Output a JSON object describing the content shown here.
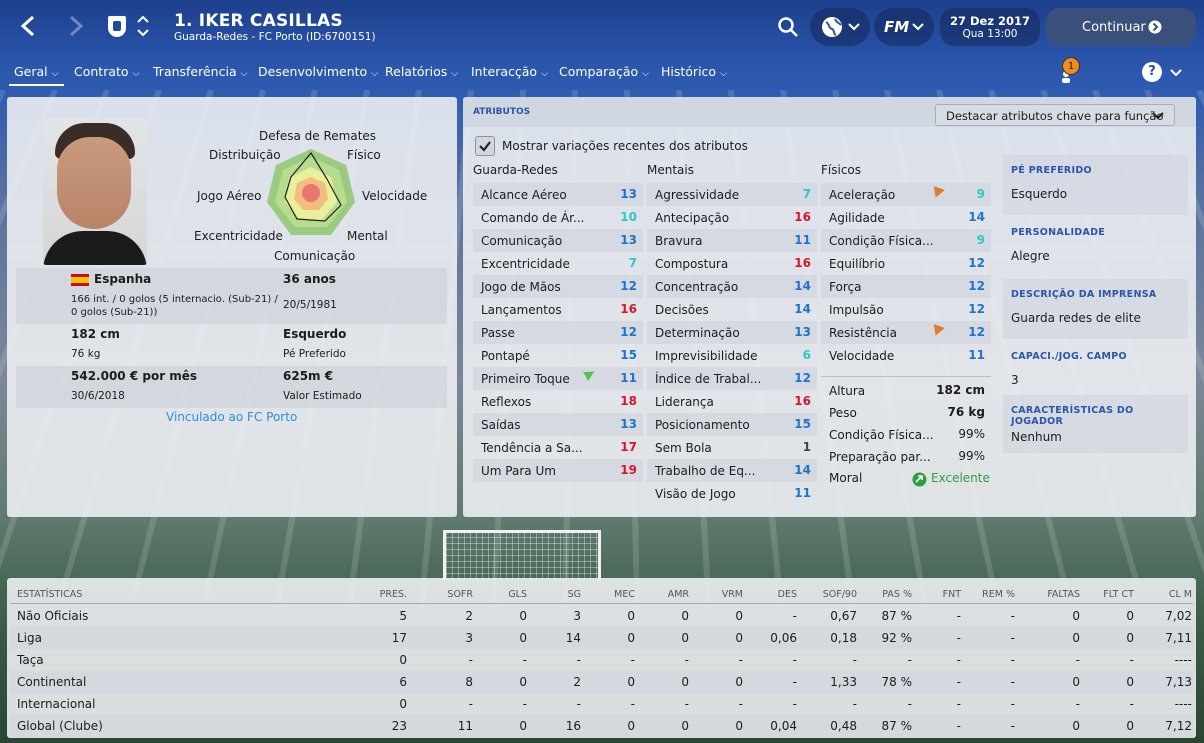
{
  "header": {
    "player_name": "1. IKER CASILLAS",
    "subtitle": "Guarda-Redes - FC Porto (ID:6700151)",
    "date": "27 Dez 2017",
    "day_time": "Qua 13:00",
    "fm_label": "FM",
    "continue_label": "Continuar",
    "notification_count": "1",
    "help_label": "?"
  },
  "nav": {
    "tabs": [
      "Geral",
      "Contrato",
      "Transferência",
      "Desenvolvimento",
      "Relatórios",
      "Interacção",
      "Comparação",
      "Histórico"
    ]
  },
  "profile": {
    "radar_labels": {
      "top": "Defesa de Remates",
      "top_left": "Distribuição",
      "top_right": "Físico",
      "left": "Jogo Aéreo",
      "right": "Velocidade",
      "bottom_left": "Excentricidade",
      "bottom_right": "Mental",
      "bottom": "Comunicação"
    },
    "nationality": "Espanha",
    "caps": "166 int. / 0 golos (5 internacio. (Sub-21) / 0 golos (Sub-21))",
    "age": "36 anos",
    "birth_date": "20/5/1981",
    "height": "182 cm",
    "weight": "76 kg",
    "preferred_foot": "Esquerdo",
    "preferred_foot_label": "Pé Preferido",
    "wage": "542.000 € por mês",
    "contract_end": "30/6/2018",
    "value": "625m €",
    "value_label": "Valor Estimado",
    "club_link": "Vinculado ao FC Porto"
  },
  "attributes": {
    "panel_title": "ATRIBUTOS",
    "highlight_dropdown": "Destacar atributos chave para função",
    "show_changes_label": "Mostrar variações recentes dos atributos",
    "gk_title": "Guarda-Redes",
    "mental_title": "Mentais",
    "physical_title": "Físicos",
    "goalkeeping": [
      {
        "name": "Alcance Aéreo",
        "value": "13"
      },
      {
        "name": "Comando de Ár...",
        "value": "10"
      },
      {
        "name": "Comunicação",
        "value": "13"
      },
      {
        "name": "Excentricidade",
        "value": "7"
      },
      {
        "name": "Jogo de Mãos",
        "value": "12"
      },
      {
        "name": "Lançamentos",
        "value": "16"
      },
      {
        "name": "Passe",
        "value": "12"
      },
      {
        "name": "Pontapé",
        "value": "15"
      },
      {
        "name": "Primeiro Toque",
        "value": "11"
      },
      {
        "name": "Reflexos",
        "value": "18"
      },
      {
        "name": "Saídas",
        "value": "13"
      },
      {
        "name": "Tendência a Sa...",
        "value": "17"
      },
      {
        "name": "Um Para Um",
        "value": "19"
      }
    ],
    "mental": [
      {
        "name": "Agressividade",
        "value": "7"
      },
      {
        "name": "Antecipação",
        "value": "16"
      },
      {
        "name": "Bravura",
        "value": "11"
      },
      {
        "name": "Compostura",
        "value": "16"
      },
      {
        "name": "Concentração",
        "value": "14"
      },
      {
        "name": "Decisões",
        "value": "14"
      },
      {
        "name": "Determinação",
        "value": "13"
      },
      {
        "name": "Imprevisibilidade",
        "value": "6"
      },
      {
        "name": "Índice de Trabal...",
        "value": "12"
      },
      {
        "name": "Liderança",
        "value": "16"
      },
      {
        "name": "Posicionamento",
        "value": "15"
      },
      {
        "name": "Sem Bola",
        "value": "1"
      },
      {
        "name": "Trabalho de Eq...",
        "value": "14"
      },
      {
        "name": "Visão de Jogo",
        "value": "11"
      }
    ],
    "physical": [
      {
        "name": "Aceleração",
        "value": "9"
      },
      {
        "name": "Agilidade",
        "value": "14"
      },
      {
        "name": "Condição Física...",
        "value": "9"
      },
      {
        "name": "Equilíbrio",
        "value": "12"
      },
      {
        "name": "Força",
        "value": "12"
      },
      {
        "name": "Impulsão",
        "value": "12"
      },
      {
        "name": "Resistência",
        "value": "12"
      },
      {
        "name": "Velocidade",
        "value": "11"
      }
    ],
    "body": [
      {
        "name": "Altura",
        "value": "182 cm"
      },
      {
        "name": "Peso",
        "value": "76 kg"
      },
      {
        "name": "Condição Física...",
        "value": "99%"
      },
      {
        "name": "Preparação par...",
        "value": "99%"
      }
    ],
    "morale_label": "Moral",
    "morale_value": "Excelente"
  },
  "side_info": {
    "foot_title": "PÉ PREFERIDO",
    "foot_value": "Esquerdo",
    "personality_title": "PERSONALIDADE",
    "personality_value": "Alegre",
    "press_title": "DESCRIÇÃO DA IMPRENSA",
    "press_value": "Guarda redes de elite",
    "field_title": "CAPACI./JOG. CAMPO",
    "field_value": "3",
    "traits_title": "CARACTERÍSTICAS DO JOGADOR",
    "traits_value": "Nenhum"
  },
  "stats": {
    "title": "ESTATÍSTICAS",
    "columns": [
      "PRES.",
      "SOFR",
      "GLS",
      "SG",
      "MEC",
      "AMR",
      "VRM",
      "DES",
      "SOF/90",
      "PAS %",
      "FNT",
      "REM %",
      "FALTAS",
      "FLT CT",
      "CL M"
    ],
    "rows": [
      {
        "label": "Não Oficiais",
        "cells": [
          "5",
          "2",
          "0",
          "3",
          "0",
          "0",
          "0",
          "-",
          "0,67",
          "87 %",
          "-",
          "-",
          "0",
          "0",
          "7,02"
        ]
      },
      {
        "label": "Liga",
        "cells": [
          "17",
          "3",
          "0",
          "14",
          "0",
          "0",
          "0",
          "0,06",
          "0,18",
          "92 %",
          "-",
          "-",
          "0",
          "0",
          "7,11"
        ]
      },
      {
        "label": "Taça",
        "cells": [
          "0",
          "-",
          "-",
          "-",
          "-",
          "-",
          "-",
          "-",
          "-",
          "-",
          "-",
          "-",
          "-",
          "-",
          "----"
        ]
      },
      {
        "label": "Continental",
        "cells": [
          "6",
          "8",
          "0",
          "2",
          "0",
          "0",
          "0",
          "-",
          "1,33",
          "78 %",
          "-",
          "-",
          "0",
          "0",
          "7,13"
        ]
      },
      {
        "label": "Internacional",
        "cells": [
          "0",
          "-",
          "-",
          "-",
          "-",
          "-",
          "-",
          "-",
          "-",
          "-",
          "-",
          "-",
          "-",
          "-",
          "----"
        ]
      },
      {
        "label": "Global (Clube)",
        "cells": [
          "23",
          "11",
          "0",
          "16",
          "0",
          "0",
          "0",
          "0,04",
          "0,48",
          "87 %",
          "-",
          "-",
          "0",
          "0",
          "7,12"
        ]
      }
    ]
  },
  "colors": {
    "accent_blue": "#1f73c8",
    "red_high": "#d8152a",
    "cyan_low": "#2ec6c0",
    "morale_green": "#2f9e3a"
  }
}
